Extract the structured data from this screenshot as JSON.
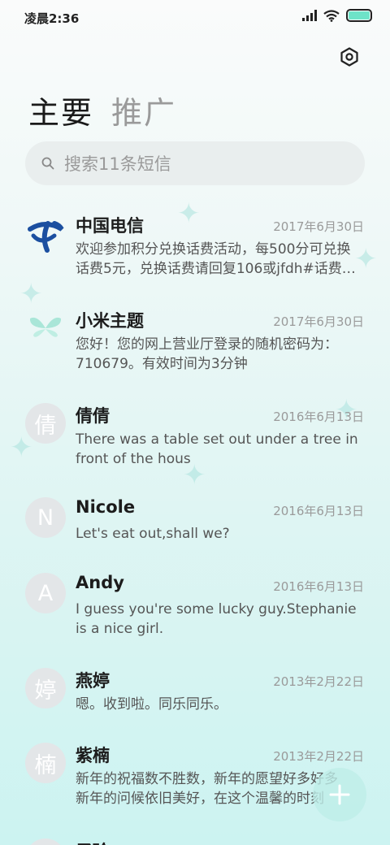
{
  "status": {
    "time": "凌晨2:36"
  },
  "tabs": {
    "primary": "主要",
    "promo": "推广"
  },
  "search": {
    "placeholder": "搜索11条短信"
  },
  "colors": {
    "accent": "#6ee3c8",
    "telecom_blue": "#1b4fa0",
    "avatar_bg": "#e3e6e8"
  },
  "messages": [
    {
      "sender": "中国电信",
      "date": "2017年6月30日",
      "avatar": "china-telecom-logo",
      "lines": [
        "欢迎参加积分兑换话费活动，每500分可兑换",
        "话费5元，兑换话费请回复106或jfdh#话费…"
      ]
    },
    {
      "sender": "小米主题",
      "date": "2017年6月30日",
      "avatar": "butterfly-icon",
      "lines": [
        "您好！您的网上营业厅登录的随机密码为：",
        "710679。有效时间为3分钟"
      ]
    },
    {
      "sender": "倩倩",
      "date": "2016年6月13日",
      "avatar_letter": "倩",
      "lines": [
        "There was a table set out under a tree in",
        "front of the hous"
      ]
    },
    {
      "sender": "Nicole",
      "date": "2016年6月13日",
      "avatar_letter": "N",
      "lines": [
        "Let's eat out,shall we?"
      ]
    },
    {
      "sender": "Andy",
      "date": "2016年6月13日",
      "avatar_letter": "A",
      "lines": [
        "I guess you're some lucky guy.Stephanie",
        "is a nice girl."
      ]
    },
    {
      "sender": "燕婷",
      "date": "2013年2月22日",
      "avatar_letter": "婷",
      "lines": [
        "嗯。收到啦。同乐同乐。"
      ]
    },
    {
      "sender": "紫楠",
      "date": "2013年2月22日",
      "avatar_letter": "楠",
      "lines": [
        "新年的祝福数不胜数，新年的愿望好多好多",
        "新年的问候依旧美好，在这个温馨的时刻"
      ]
    },
    {
      "sender": "子玲",
      "date": "",
      "avatar_letter": "",
      "lines": []
    }
  ],
  "fab": {
    "label": "+"
  }
}
